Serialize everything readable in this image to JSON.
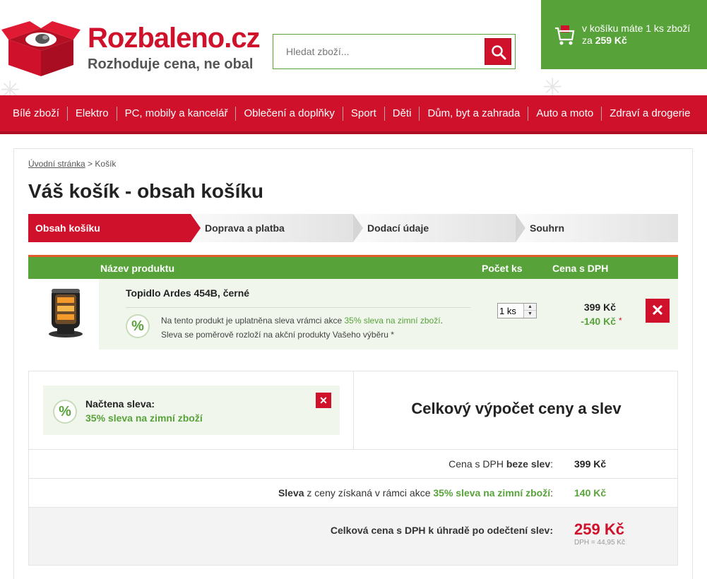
{
  "logo": {
    "title": "Rozbaleno.cz",
    "slogan": "Rozhoduje cena, ne obal"
  },
  "search": {
    "placeholder": "Hledat zboží..."
  },
  "cart": {
    "line1": "v košíku máte 1 ks zboží",
    "line2_prefix": "za",
    "amount": "259 Kč"
  },
  "nav": {
    "items": [
      "Bílé zboží",
      "Elektro",
      "PC, mobily a kancelář",
      "Oblečení a doplňky",
      "Sport",
      "Děti",
      "Dům, byt a zahrada",
      "Auto a moto",
      "Zdraví a drogerie"
    ]
  },
  "breadcrumb": {
    "home": "Úvodní stránka",
    "separator": " > ",
    "current": "Košík"
  },
  "page_title": "Váš košík - obsah košíku",
  "steps": [
    "Obsah košíku",
    "Doprava a platba",
    "Dodací údaje",
    "Souhrn"
  ],
  "table": {
    "col_name": "Název produktu",
    "col_qty": "Počet ks",
    "col_price": "Cena s DPH"
  },
  "product": {
    "name": "Topidlo Ardes 454B, černé",
    "discount_text_prefix": "Na tento produkt je uplatněna sleva vrámci akce",
    "discount_campaign": "35% sleva na zimní zboží",
    "discount_text_suffix": ".",
    "discount_note": "Sleva se poměrově rozloží na akční produkty Vašeho výběru *",
    "quantity": "1 ks",
    "price": "399 Kč",
    "price_discount": "-140 Kč",
    "star": "*"
  },
  "summary": {
    "applied_label": "Načtena sleva:",
    "applied_value": "35% sleva na zimní zboží",
    "title": "Celkový výpočet ceny a slev",
    "row1_label_prefix": "Cena s DPH",
    "row1_label_bold": "beze slev",
    "row1_label_suffix": ":",
    "row1_value": "399 Kč",
    "row2_label_bold": "Sleva",
    "row2_label_mid": "z ceny získaná v rámci akce",
    "row2_campaign": "35% sleva na zimní zboží",
    "row2_label_suffix": ":",
    "row2_value": "140 Kč",
    "row3_label": "Celková cena s DPH k úhradě po odečtení slev:",
    "row3_value": "259 Kč",
    "row3_vat": "DPH = 44,95 Kč"
  },
  "colors": {
    "brand_red": "#d0112b",
    "brand_green": "#57a33a"
  }
}
